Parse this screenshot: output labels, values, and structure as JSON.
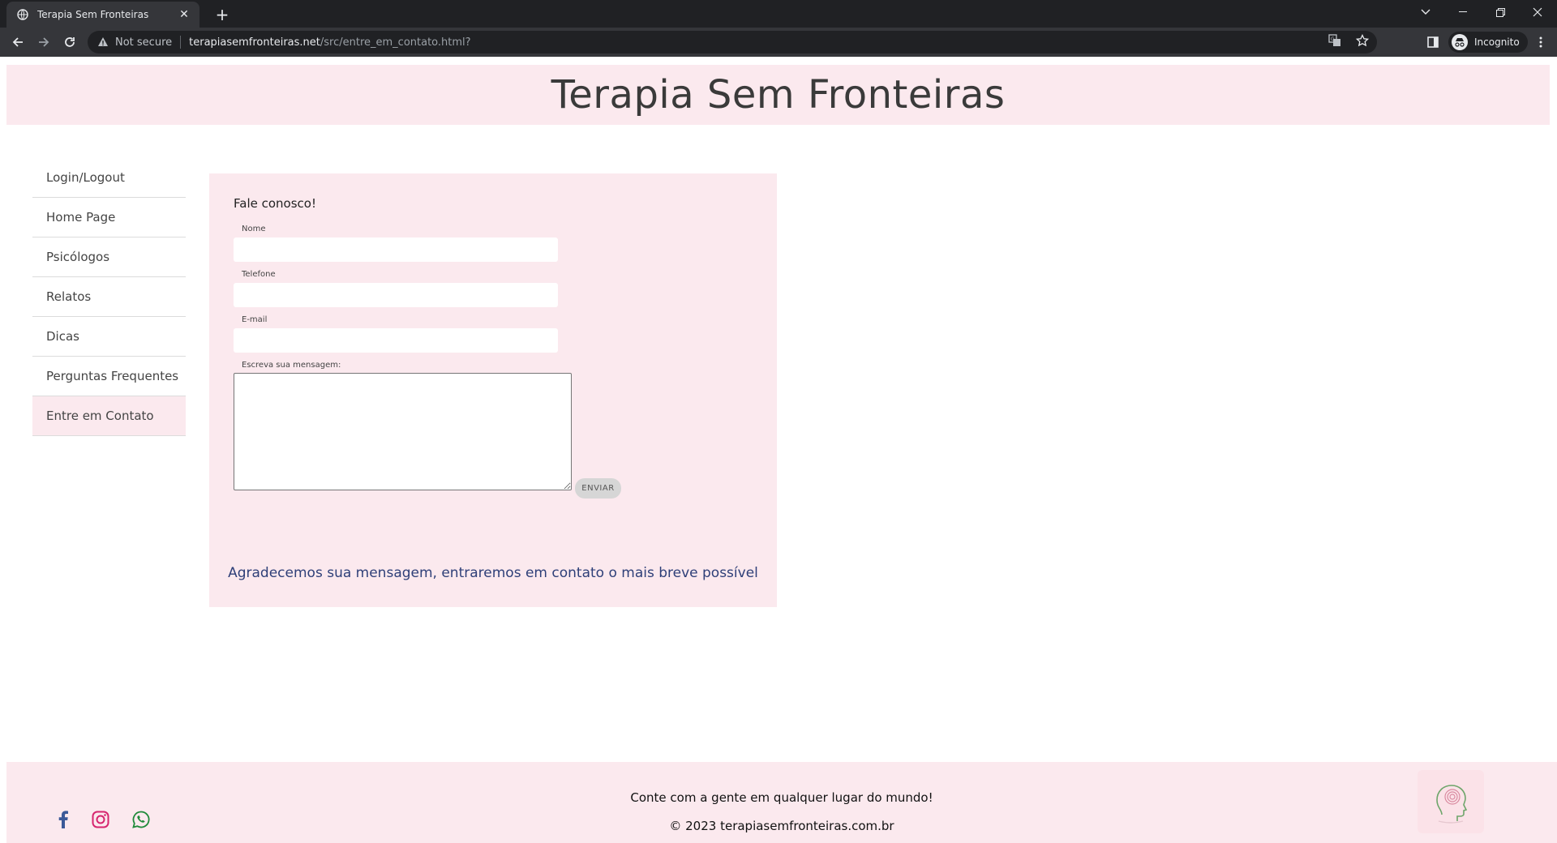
{
  "browser": {
    "tab_title": "Terapia Sem Fronteiras",
    "new_tab": "+",
    "security": "Not secure",
    "url_host": "terapiasemfronteiras.net",
    "url_path": "/src/entre_em_contato.html?",
    "profile": "Incognito"
  },
  "site": {
    "title": "Terapia Sem Fronteiras"
  },
  "sidebar": {
    "items": [
      {
        "label": "Login/Logout"
      },
      {
        "label": "Home Page"
      },
      {
        "label": "Psicólogos"
      },
      {
        "label": "Relatos"
      },
      {
        "label": "Dicas"
      },
      {
        "label": "Perguntas Frequentes"
      },
      {
        "label": "Entre em Contato",
        "active": true
      }
    ]
  },
  "form": {
    "title": "Fale conosco!",
    "name_label": "Nome",
    "phone_label": "Telefone",
    "email_label": "E-mail",
    "message_label": "Escreva sua mensagem:",
    "submit": "ENVIAR",
    "thanks": "Agradecemos sua mensagem, entraremos em contato o mais breve possível"
  },
  "footer": {
    "tagline": "Conte com a gente em qualquer lugar do mundo!",
    "copyright": "© 2023 terapiasemfronteiras.com.br"
  },
  "colors": {
    "pink_bg": "#fbe9ee",
    "link_blue": "#2e3f78",
    "facebook": "#3b5998",
    "instagram": "#d6246e",
    "whatsapp": "#1f8a3a"
  }
}
